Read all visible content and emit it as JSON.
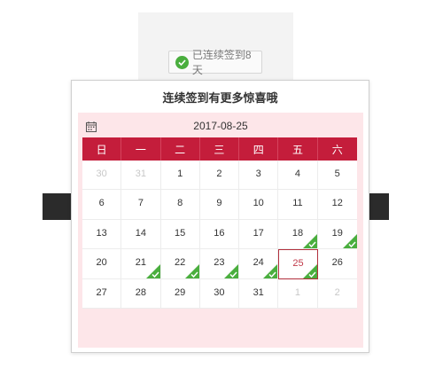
{
  "badge": {
    "icon": "check-circle-icon",
    "label": "已连续签到8天",
    "color": "#4aae3e"
  },
  "popup": {
    "title": "连续签到有更多惊喜哦",
    "calendar_icon": "calendar-icon",
    "current_date": "2017-08-25",
    "weekday_headers": [
      "日",
      "一",
      "二",
      "三",
      "四",
      "五",
      "六"
    ],
    "header_color": "#c41d3b",
    "weeks": [
      [
        {
          "day": "30",
          "other_month": true,
          "signed": false,
          "today": false
        },
        {
          "day": "31",
          "other_month": true,
          "signed": false,
          "today": false
        },
        {
          "day": "1",
          "other_month": false,
          "signed": false,
          "today": false
        },
        {
          "day": "2",
          "other_month": false,
          "signed": false,
          "today": false
        },
        {
          "day": "3",
          "other_month": false,
          "signed": false,
          "today": false
        },
        {
          "day": "4",
          "other_month": false,
          "signed": false,
          "today": false
        },
        {
          "day": "5",
          "other_month": false,
          "signed": false,
          "today": false
        }
      ],
      [
        {
          "day": "6",
          "other_month": false,
          "signed": false,
          "today": false
        },
        {
          "day": "7",
          "other_month": false,
          "signed": false,
          "today": false
        },
        {
          "day": "8",
          "other_month": false,
          "signed": false,
          "today": false
        },
        {
          "day": "9",
          "other_month": false,
          "signed": false,
          "today": false
        },
        {
          "day": "10",
          "other_month": false,
          "signed": false,
          "today": false
        },
        {
          "day": "11",
          "other_month": false,
          "signed": false,
          "today": false
        },
        {
          "day": "12",
          "other_month": false,
          "signed": false,
          "today": false
        }
      ],
      [
        {
          "day": "13",
          "other_month": false,
          "signed": false,
          "today": false
        },
        {
          "day": "14",
          "other_month": false,
          "signed": false,
          "today": false
        },
        {
          "day": "15",
          "other_month": false,
          "signed": false,
          "today": false
        },
        {
          "day": "16",
          "other_month": false,
          "signed": false,
          "today": false
        },
        {
          "day": "17",
          "other_month": false,
          "signed": false,
          "today": false
        },
        {
          "day": "18",
          "other_month": false,
          "signed": true,
          "today": false
        },
        {
          "day": "19",
          "other_month": false,
          "signed": true,
          "today": false
        }
      ],
      [
        {
          "day": "20",
          "other_month": false,
          "signed": false,
          "today": false
        },
        {
          "day": "21",
          "other_month": false,
          "signed": true,
          "today": false
        },
        {
          "day": "22",
          "other_month": false,
          "signed": true,
          "today": false
        },
        {
          "day": "23",
          "other_month": false,
          "signed": true,
          "today": false
        },
        {
          "day": "24",
          "other_month": false,
          "signed": true,
          "today": false
        },
        {
          "day": "25",
          "other_month": false,
          "signed": true,
          "today": true
        },
        {
          "day": "26",
          "other_month": false,
          "signed": false,
          "today": false
        }
      ],
      [
        {
          "day": "27",
          "other_month": false,
          "signed": false,
          "today": false
        },
        {
          "day": "28",
          "other_month": false,
          "signed": false,
          "today": false
        },
        {
          "day": "29",
          "other_month": false,
          "signed": false,
          "today": false
        },
        {
          "day": "30",
          "other_month": false,
          "signed": false,
          "today": false
        },
        {
          "day": "31",
          "other_month": false,
          "signed": false,
          "today": false
        },
        {
          "day": "1",
          "other_month": true,
          "signed": false,
          "today": false
        },
        {
          "day": "2",
          "other_month": true,
          "signed": false,
          "today": false
        }
      ]
    ]
  }
}
